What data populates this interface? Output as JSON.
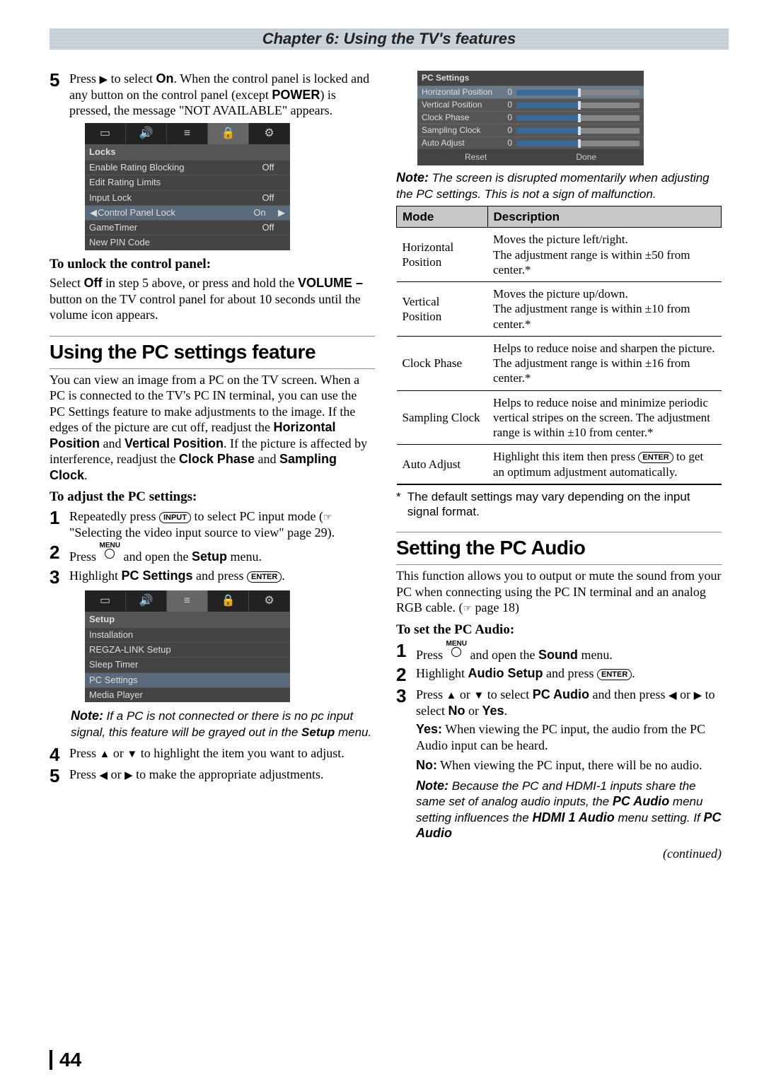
{
  "chapter_title": "Chapter 6: Using the TV's features",
  "left": {
    "step5": {
      "num": "5",
      "pre": "Press ",
      "arrow": "▶",
      "mid": " to select ",
      "on": "On",
      "post1": ". When the control panel is locked and any button on the control panel (except ",
      "power": "POWER",
      "post2": ") is pressed, the message \"NOT AVAILABLE\" appears."
    },
    "osd1": {
      "title": "Locks",
      "rows": [
        {
          "label": "Enable Rating Blocking",
          "value": "Off"
        },
        {
          "label": "Edit Rating Limits",
          "value": ""
        },
        {
          "label": "Input Lock",
          "value": "Off"
        },
        {
          "label": "Control Panel Lock",
          "value": "On",
          "sel": true
        },
        {
          "label": "GameTimer",
          "value": "Off"
        },
        {
          "label": "New PIN Code",
          "value": ""
        }
      ]
    },
    "unlock_head": "To unlock the control panel:",
    "unlock_p1a": "Select ",
    "unlock_off": "Off",
    "unlock_p1b": " in step 5 above, or press and hold the ",
    "unlock_vol": "VOLUME –",
    "unlock_p1c": " button on the TV control panel for about 10 seconds until the volume icon appears.",
    "h2_pc": "Using the PC settings feature",
    "pc_p1": "You can view an image from a PC on the TV screen. When a PC is connected to the TV's PC IN terminal, you can use the PC Settings feature to make adjustments to the image. If the edges of the picture are cut off, readjust the ",
    "pc_hp": "Horizontal Position",
    "pc_and": " and ",
    "pc_vp": "Vertical Position",
    "pc_p2": ". If the picture is affected by interference, readjust the ",
    "pc_cp": "Clock Phase",
    "pc_and2": " and ",
    "pc_sc": "Sampling Clock",
    "pc_period": ".",
    "adjust_head": "To adjust the PC settings:",
    "s1": {
      "num": "1",
      "a": "Repeatedly press ",
      "key": "INPUT",
      "b": " to select PC input mode (",
      "ptr": "☞",
      "c": " \"Selecting the video input source to view\" page 29)."
    },
    "s2": {
      "num": "2",
      "a": "Press ",
      "menu": "MENU",
      "b": " and open the ",
      "setup": "Setup",
      "c": " menu."
    },
    "s3": {
      "num": "3",
      "a": "Highlight ",
      "pcs": "PC Settings",
      "b": " and press ",
      "key": "ENTER",
      "c": "."
    },
    "osd2": {
      "title": "Setup",
      "rows": [
        {
          "label": "Installation"
        },
        {
          "label": "REGZA-LINK Setup"
        },
        {
          "label": "Sleep Timer"
        },
        {
          "label": "PC Settings",
          "sel": true
        },
        {
          "label": "Media Player"
        }
      ]
    },
    "note1": {
      "label": "Note:",
      "text": " If a PC is not connected or there is no pc input signal, this feature will be grayed out in the ",
      "setup": "Setup",
      "tail": " menu."
    },
    "s4": {
      "num": "4",
      "a": "Press ",
      "up": "▲",
      "or": " or ",
      "down": "▼",
      "b": " to highlight the item you want to adjust."
    },
    "s5": {
      "num": "5",
      "a": "Press ",
      "left": "◀",
      "or": " or ",
      "right": "▶",
      "b": " to make the appropriate adjustments."
    }
  },
  "right": {
    "osd3": {
      "title": "PC Settings",
      "rows": [
        {
          "label": "Horizontal Position",
          "value": "0",
          "sel": true
        },
        {
          "label": "Vertical Position",
          "value": "0"
        },
        {
          "label": "Clock Phase",
          "value": "0"
        },
        {
          "label": "Sampling Clock",
          "value": "0"
        },
        {
          "label": "Auto Adjust",
          "value": "0"
        }
      ],
      "btn_reset": "Reset",
      "btn_done": "Done"
    },
    "note2": {
      "label": "Note:",
      "text": " The screen is disrupted momentarily when adjusting the PC settings. This is not a sign of malfunction."
    },
    "table": {
      "h1": "Mode",
      "h2": "Description",
      "rows": [
        {
          "mode": "Horizontal Position",
          "desc": "Moves the picture left/right.\nThe adjustment range is within ±50 from center.*"
        },
        {
          "mode": "Vertical Position",
          "desc": "Moves the picture up/down.\nThe adjustment range is within ±10 from center.*"
        },
        {
          "mode": "Clock Phase",
          "desc": "Helps to reduce noise and sharpen the picture.\nThe adjustment range is within ±16 from center.*"
        },
        {
          "mode": "Sampling Clock",
          "desc": "Helps to reduce noise and minimize periodic vertical stripes on the screen. The adjustment range is within ±10 from center.*"
        }
      ],
      "auto": {
        "mode": "Auto Adjust",
        "a": "Highlight this item then press ",
        "key": "ENTER",
        "b": " to get an optimum adjustment automatically."
      }
    },
    "footnote": {
      "star": "*",
      "text": "The default settings may vary depending on the input signal format."
    },
    "h2_audio": "Setting the PC Audio",
    "audio_p1": "This function allows you to output or mute the sound from your PC when connecting using the PC IN terminal and an analog RGB cable. (",
    "audio_ptr": "☞",
    "audio_p1b": " page 18)",
    "set_head": "To set the PC Audio:",
    "a1": {
      "num": "1",
      "a": "Press ",
      "menu": "MENU",
      "b": " and open the ",
      "sound": "Sound",
      "c": " menu."
    },
    "a2": {
      "num": "2",
      "a": "Highlight ",
      "as": "Audio Setup",
      "b": " and press ",
      "key": "ENTER",
      "c": "."
    },
    "a3": {
      "num": "3",
      "a": "Press ",
      "up": "▲",
      "or": " or ",
      "down": "▼",
      "b": " to select ",
      "pca": "PC Audio",
      "c": " and then press ",
      "left": "◀",
      "or2": " or ",
      "right": "▶",
      "d": " to select ",
      "no": "No",
      "or3": " or ",
      "yes": "Yes",
      "e": "."
    },
    "yes_lbl": "Yes:",
    "yes_txt": " When viewing the PC input, the audio from the PC Audio input can be heard.",
    "no_lbl": "No:",
    "no_txt": " When viewing the PC input, there will be no audio.",
    "note3": {
      "label": "Note:",
      "a": " Because the PC and HDMI-1 inputs share the same set of analog audio inputs, the ",
      "pca": "PC Audio",
      "b": " menu setting influences the ",
      "h1a": "HDMI 1 Audio",
      "c": " menu setting. If ",
      "pca2": "PC Audio"
    },
    "continued": "(continued)"
  },
  "page_num": "44"
}
